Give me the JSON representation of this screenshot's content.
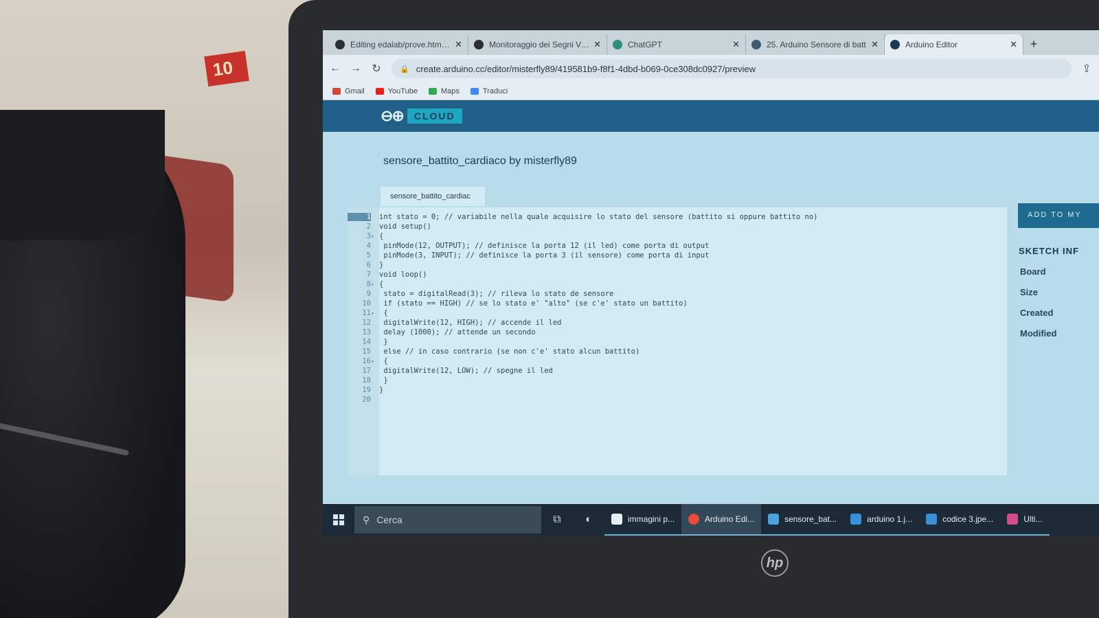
{
  "browser": {
    "tabs": [
      {
        "title": "Editing edalab/prove.html at",
        "icon": "github-icon"
      },
      {
        "title": "Monitoraggio dei Segni Vita",
        "icon": "github-icon"
      },
      {
        "title": "ChatGPT",
        "icon": "chatgpt-icon"
      },
      {
        "title": "25. Arduino Sensore di batt",
        "icon": "globe-icon"
      },
      {
        "title": "Arduino Editor",
        "icon": "arduino-icon"
      }
    ],
    "active_tab": 4,
    "url": "create.arduino.cc/editor/misterfly89/419581b9-f8f1-4dbd-b069-0ce308dc0927/preview",
    "bookmarks": [
      "Gmail",
      "YouTube",
      "Maps",
      "Traduci"
    ]
  },
  "arduino": {
    "cloud_label": "CLOUD",
    "sketch_title": "sensore_battito_cardiaco by misterfly89",
    "file_tab": "sensore_battito_cardiac",
    "add_button": "ADD TO MY",
    "info_heading": "SKETCH INF",
    "info_labels": [
      "Board",
      "Size",
      "Created",
      "Modified"
    ]
  },
  "code": [
    {
      "n": "1",
      "fold": "",
      "text": "int stato = 0; // variabile nella quale acquisire lo stato del sensore (battito si oppure battito no)"
    },
    {
      "n": "2",
      "fold": "",
      "text": "void setup()"
    },
    {
      "n": "3",
      "fold": "▾",
      "text": "{"
    },
    {
      "n": "4",
      "fold": "",
      "text": " pinMode(12, OUTPUT); // definisce la porta 12 (il led) come porta di output"
    },
    {
      "n": "5",
      "fold": "",
      "text": " pinMode(3, INPUT); // definisce la porta 3 (il sensore) come porta di input"
    },
    {
      "n": "6",
      "fold": "",
      "text": "}"
    },
    {
      "n": "7",
      "fold": "",
      "text": "void loop()"
    },
    {
      "n": "8",
      "fold": "▾",
      "text": "{"
    },
    {
      "n": "9",
      "fold": "",
      "text": " stato = digitalRead(3); // rileva lo stato de sensore"
    },
    {
      "n": "10",
      "fold": "",
      "text": " if (stato == HIGH) // se lo stato e' \"alto\" (se c'e' stato un battito)"
    },
    {
      "n": "11",
      "fold": "▾",
      "text": " {"
    },
    {
      "n": "12",
      "fold": "",
      "text": " digitalWrite(12, HIGH); // accende il led"
    },
    {
      "n": "13",
      "fold": "",
      "text": " delay (1000); // attende un secondo"
    },
    {
      "n": "14",
      "fold": "",
      "text": " }"
    },
    {
      "n": "15",
      "fold": "",
      "text": " else // in caso contrario (se non c'e' stato alcun battito)"
    },
    {
      "n": "16",
      "fold": "▾",
      "text": " {"
    },
    {
      "n": "17",
      "fold": "",
      "text": " digitalWrite(12, LOW); // spegne il led"
    },
    {
      "n": "18",
      "fold": "",
      "text": " }"
    },
    {
      "n": "19",
      "fold": "",
      "text": "}"
    },
    {
      "n": "20",
      "fold": "",
      "text": ""
    }
  ],
  "taskbar": {
    "search_placeholder": "Cerca",
    "apps": [
      {
        "label": "immagini p...",
        "color": "#e8eef2"
      },
      {
        "label": "Arduino Edi...",
        "color": "#e64b3c"
      },
      {
        "label": "sensore_bat...",
        "color": "#4aa3df"
      },
      {
        "label": "arduino 1.j...",
        "color": "#3a8fd6"
      },
      {
        "label": "codice 3.jpe...",
        "color": "#3a8fd6"
      },
      {
        "label": "Ulti...",
        "color": "#d34d8a"
      }
    ]
  },
  "scene": {
    "tag_text": "10",
    "laptop_logo": "hp"
  },
  "colors": {
    "arduino_header": "#1f5f88",
    "editor_bg": "#d2ebf4",
    "taskbar": "#1b2a36"
  }
}
